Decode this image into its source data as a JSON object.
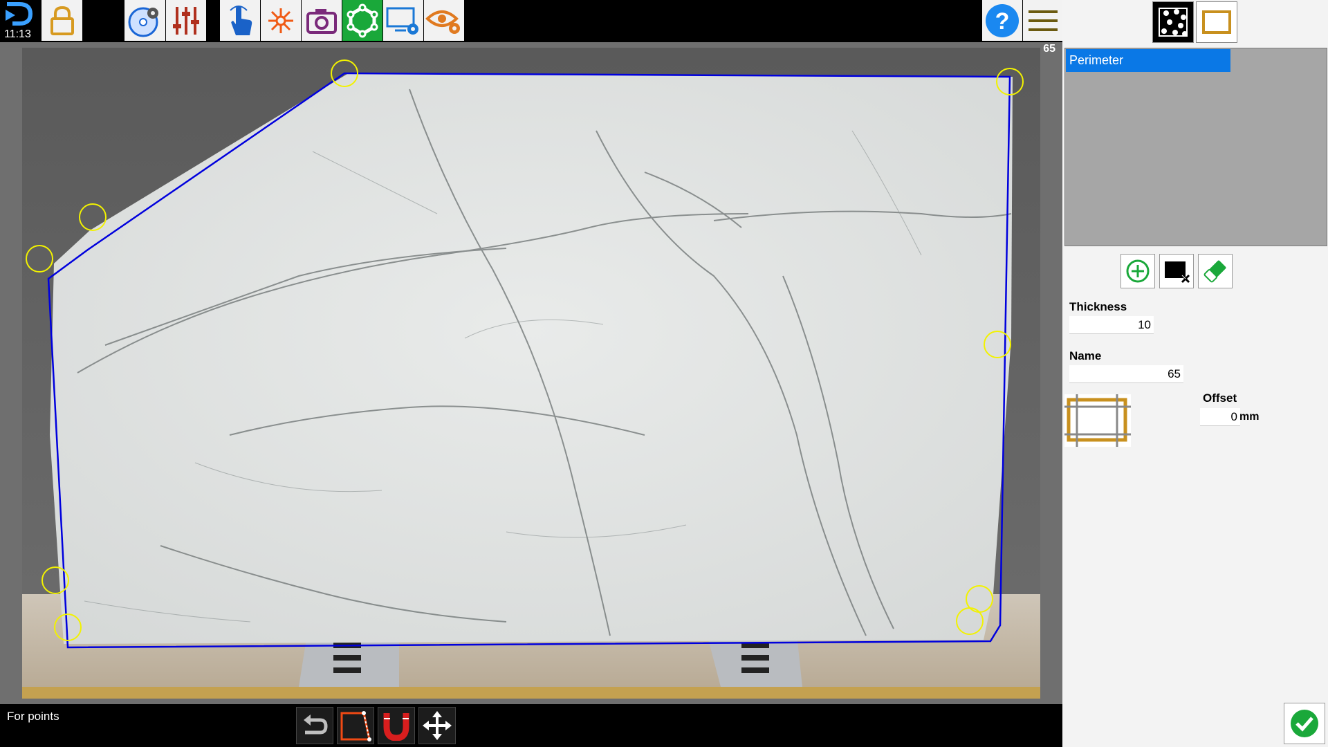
{
  "status": {
    "clock": "11:13",
    "bottom_text": "For points"
  },
  "slab": {
    "name_badge": "65"
  },
  "toolbar": {
    "icons": [
      "logo-icon",
      "lock-icon",
      "settings-disc-icon",
      "sliders-icon",
      "touch-icon",
      "laser-icon",
      "camera-icon",
      "shape-icon",
      "display-settings-icon",
      "view-settings-icon",
      "help-icon",
      "menu-icon"
    ],
    "active_icon": "shape-icon"
  },
  "bottom_tools": [
    "undo-icon",
    "edit-polygon-icon",
    "magnet-icon",
    "move-icon"
  ],
  "panel": {
    "list_items": [
      "Perimeter"
    ],
    "selected_item": "Perimeter",
    "thickness_label": "Thickness",
    "thickness_value": "10",
    "name_label": "Name",
    "name_value": "65",
    "offset_label": "Offset",
    "offset_value": "0",
    "offset_unit": "mm"
  },
  "colors": {
    "accent_blue": "#0a78e6",
    "active_green": "#1aa83a",
    "perimeter_line": "#0000dd",
    "vertex_marker": "#f2f200"
  }
}
